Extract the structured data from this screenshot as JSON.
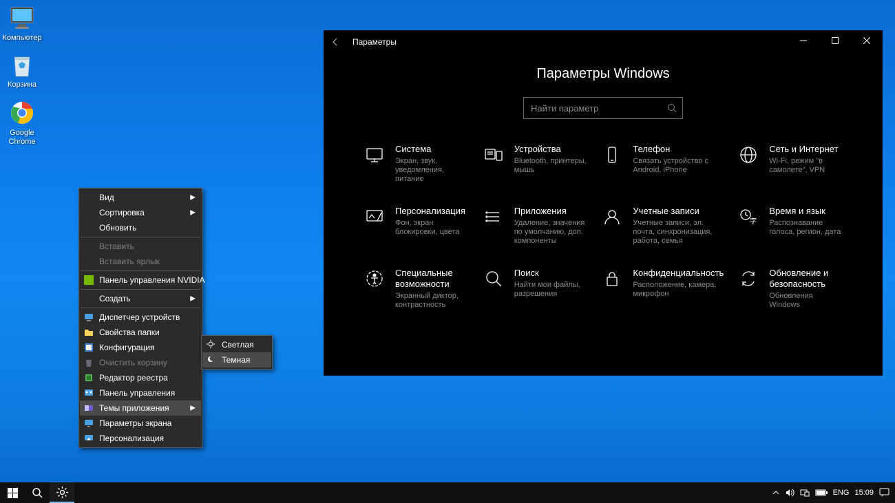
{
  "desktop_icons": {
    "computer": "Компьютер",
    "recycle_bin": "Корзина",
    "chrome": "Google Chrome"
  },
  "context_menu": {
    "view": "Вид",
    "sort": "Сортировка",
    "refresh": "Обновить",
    "paste": "Вставить",
    "paste_shortcut": "Вставить ярлык",
    "nvidia": "Панель управления NVIDIA",
    "create": "Создать",
    "device_manager": "Диспетчер устройств",
    "folder_props": "Свойства папки",
    "configuration": "Конфигурация",
    "empty_bin": "Очистить корзину",
    "regedit": "Редактор реестра",
    "control_panel": "Панель управления",
    "app_themes": "Темы приложения",
    "screen_params": "Параметры экрана",
    "personalization": "Персонализация"
  },
  "theme_submenu": {
    "light": "Светлая",
    "dark": "Темная"
  },
  "settings": {
    "window_title": "Параметры",
    "heading": "Параметры Windows",
    "search_placeholder": "Найти параметр",
    "categories": [
      {
        "title": "Система",
        "desc": "Экран, звук, уведомления, питание"
      },
      {
        "title": "Устройства",
        "desc": "Bluetooth, принтеры, мышь"
      },
      {
        "title": "Телефон",
        "desc": "Связать устройство с Android, iPhone"
      },
      {
        "title": "Сеть и Интернет",
        "desc": "Wi-Fi, режим \"в самолете\", VPN"
      },
      {
        "title": "Персонализация",
        "desc": "Фон, экран блокировки, цвета"
      },
      {
        "title": "Приложения",
        "desc": "Удаление, значения по умолчанию, доп. компоненты"
      },
      {
        "title": "Учетные записи",
        "desc": "Учетные записи, эл. почта, синхронизация, работа, семья"
      },
      {
        "title": "Время и язык",
        "desc": "Распознавание голоса, регион, дата"
      },
      {
        "title": "Специальные возможности",
        "desc": "Экранный диктор, контрастность"
      },
      {
        "title": "Поиск",
        "desc": "Найти мои файлы, разрешения"
      },
      {
        "title": "Конфиденциальность",
        "desc": "Расположение, камера, микрофон"
      },
      {
        "title": "Обновление и безопасность",
        "desc": "Обновления Windows"
      }
    ]
  },
  "taskbar": {
    "lang": "ENG",
    "time": "15:09"
  }
}
